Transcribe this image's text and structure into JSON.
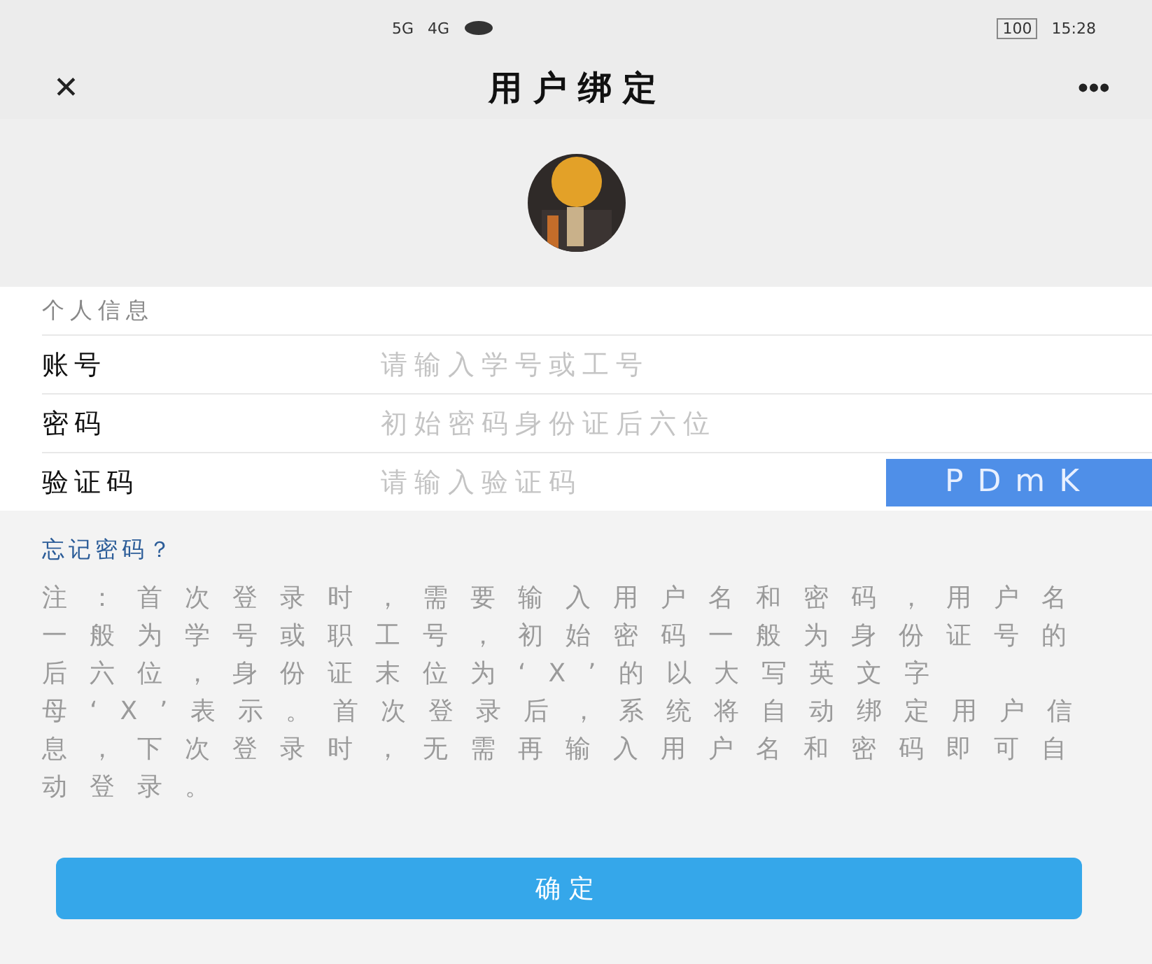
{
  "status_bar": {
    "network_1": "5G",
    "network_2": "4G",
    "battery": "100",
    "time": "15:28"
  },
  "window": {
    "title": "用户绑定",
    "close": "✕",
    "more": "•••"
  },
  "form": {
    "section_title": "个人信息",
    "fields": [
      {
        "kind": "text",
        "label": "账号",
        "placeholder": "请输入学号或工号"
      },
      {
        "kind": "text",
        "label": "密码",
        "placeholder": "初始密码身份证后六位"
      },
      {
        "kind": "captcha",
        "label": "验证码",
        "placeholder": "请输入验证码",
        "captcha": "PDmK"
      }
    ]
  },
  "forgot_link": "忘记密码？",
  "note": "注：首次登录时，需要输入用户名和密码，用户名一般为学号或职工号，初始密码一般为身份证号的后六位，身份证末位为‘X’的以大写英文字母‘X’表示。首次登录后，系统将自动绑定用户信息，下次登录时，无需再输入用户名和密码即可自动登录。",
  "buttons": [
    {
      "label": "确定"
    }
  ]
}
